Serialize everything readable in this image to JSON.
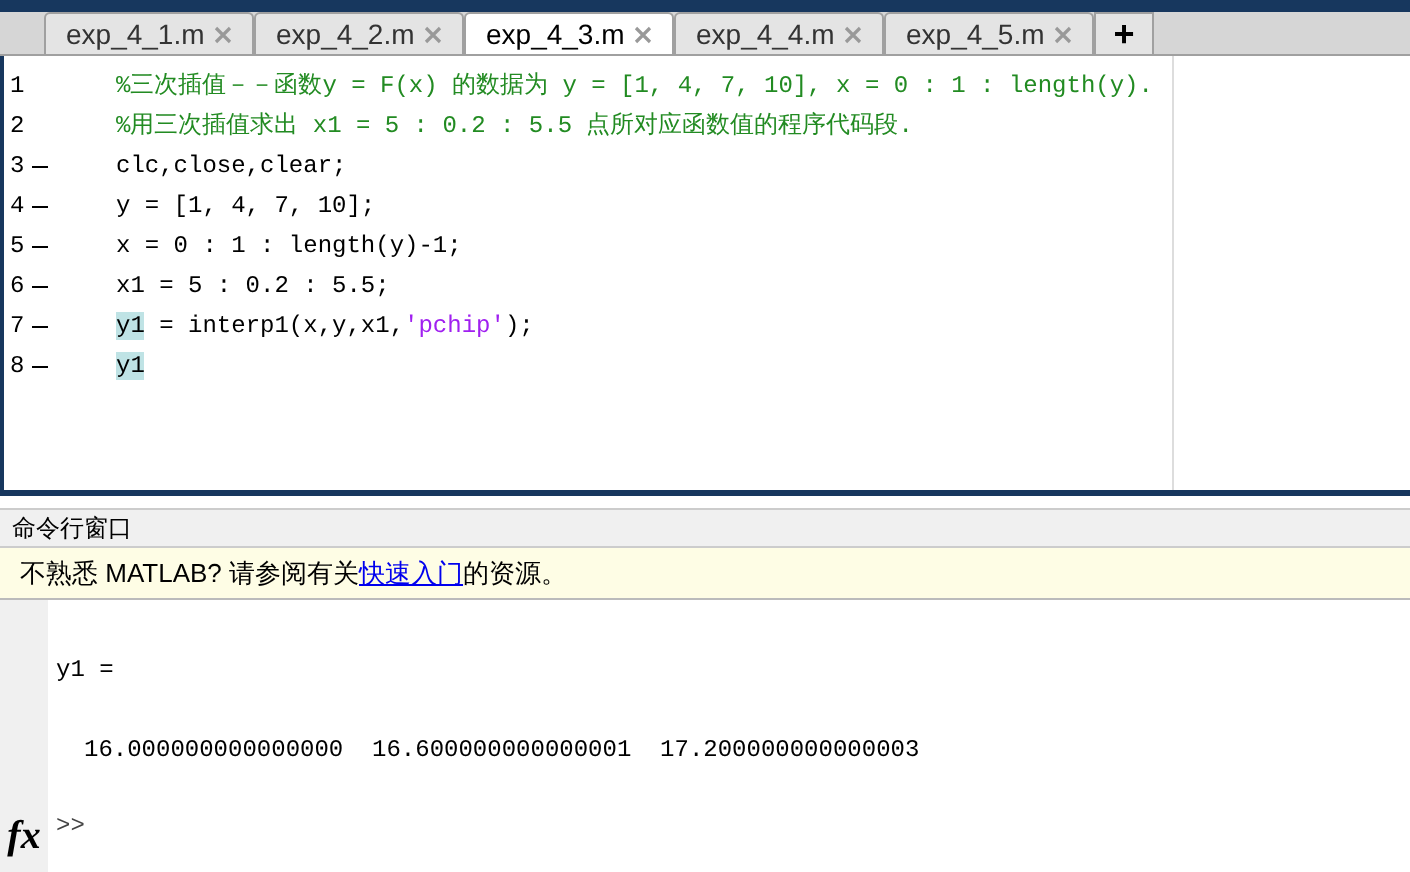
{
  "tabs": [
    {
      "label": "exp_4_1.m",
      "selected": false
    },
    {
      "label": "exp_4_2.m",
      "selected": false
    },
    {
      "label": "exp_4_3.m",
      "selected": true
    },
    {
      "label": "exp_4_4.m",
      "selected": false
    },
    {
      "label": "exp_4_5.m",
      "selected": false
    }
  ],
  "new_tab": "+",
  "editor": {
    "lines": [
      {
        "number": "1",
        "marker": false,
        "segments": [
          {
            "text": "%三次插值－－函数y = F(x) 的数据为 y = [1, 4, 7, 10], x = 0 : 1 : length(y).",
            "kind": "comment"
          }
        ]
      },
      {
        "number": "2",
        "marker": false,
        "segments": [
          {
            "text": "%用三次插值求出 x1 = 5 : 0.2 : 5.5 点所对应函数值的程序代码段.",
            "kind": "comment"
          }
        ]
      },
      {
        "number": "3",
        "marker": true,
        "segments": [
          {
            "text": "clc,close,clear;",
            "kind": "code"
          }
        ]
      },
      {
        "number": "4",
        "marker": true,
        "segments": [
          {
            "text": "y = [1, 4, 7, 10];",
            "kind": "code"
          }
        ]
      },
      {
        "number": "5",
        "marker": true,
        "segments": [
          {
            "text": "x = 0 : 1 : length(y)-1;",
            "kind": "code"
          }
        ]
      },
      {
        "number": "6",
        "marker": true,
        "segments": [
          {
            "text": "x1 = 5 : 0.2 : 5.5;",
            "kind": "code"
          }
        ]
      },
      {
        "number": "7",
        "marker": true,
        "segments": [
          {
            "text": "y1",
            "kind": "highlight"
          },
          {
            "text": " = interp1(x,y,x1,",
            "kind": "code"
          },
          {
            "text": "'pchip'",
            "kind": "string"
          },
          {
            "text": ");",
            "kind": "code"
          }
        ]
      },
      {
        "number": "8",
        "marker": true,
        "segments": [
          {
            "text": "y1",
            "kind": "highlight"
          }
        ]
      }
    ]
  },
  "command_window": {
    "title": "命令行窗口",
    "notice": {
      "before": "不熟悉 MATLAB? 请参阅有关",
      "link": "快速入门",
      "after": "的资源。"
    },
    "output": [
      "y1 =",
      "16.000000000000000  16.600000000000001  17.200000000000003"
    ],
    "prompt": ">>",
    "function_button": "fx"
  }
}
